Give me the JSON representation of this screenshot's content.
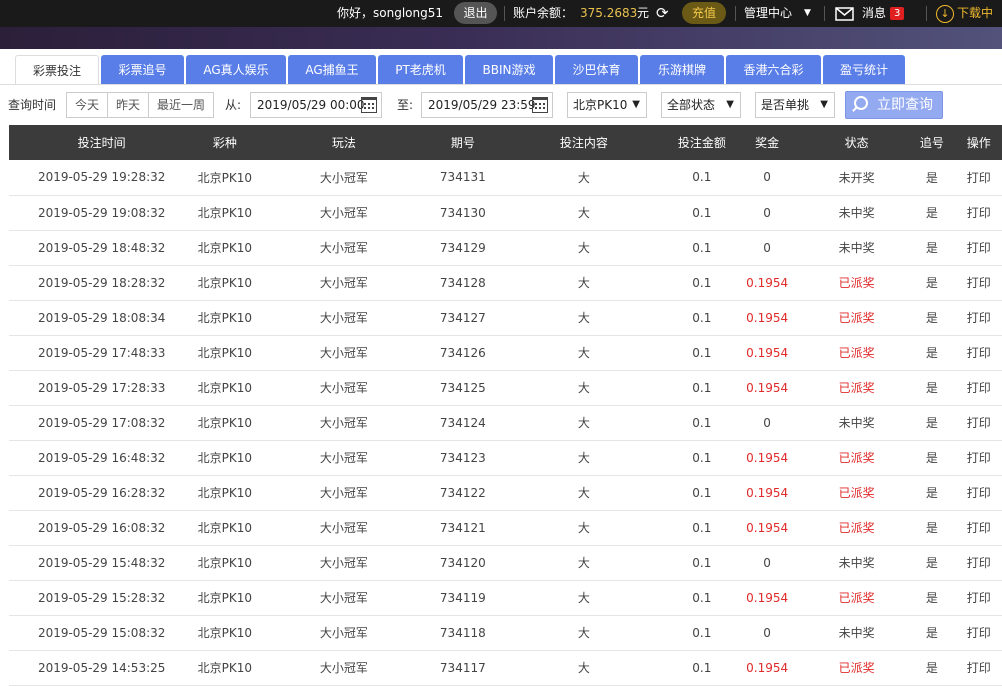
{
  "header": {
    "greeting": "你好，songlong51",
    "logout_label": "退出",
    "balance_label": "账户余额：",
    "balance_value": "375.2683",
    "balance_unit": "元",
    "recharge_label": "充值",
    "admin_label": "管理中心",
    "messages_label": "消息",
    "messages_count": "3",
    "download_label": "下载中"
  },
  "tabs": [
    {
      "label": "彩票投注",
      "active": true
    },
    {
      "label": "彩票追号"
    },
    {
      "label": "AG真人娱乐"
    },
    {
      "label": "AG捕鱼王"
    },
    {
      "label": "PT老虎机"
    },
    {
      "label": "BBIN游戏"
    },
    {
      "label": "沙巴体育"
    },
    {
      "label": "乐游棋牌"
    },
    {
      "label": "香港六合彩"
    },
    {
      "label": "盈亏统计"
    }
  ],
  "filters": {
    "query_time_label": "查询时间",
    "quick": [
      "今天",
      "昨天",
      "最近一周"
    ],
    "from_label": "从:",
    "from_value": "2019/05/29 00:00",
    "to_label": "至:",
    "to_value": "2019/05/29 23:59",
    "lottery_select": "北京PK10",
    "status_select": "全部状态",
    "single_select": "是否单挑",
    "query_button": "立即查询"
  },
  "table": {
    "columns": [
      "投注时间",
      "彩种",
      "玩法",
      "期号",
      "投注内容",
      "投注金额",
      "奖金",
      "状态",
      "追号",
      "操作"
    ],
    "rows": [
      [
        "2019-05-29 19:28:32",
        "北京PK10",
        "大小冠军",
        "734131",
        "大",
        "0.1",
        "0",
        "未开奖",
        "是",
        "打印"
      ],
      [
        "2019-05-29 19:08:32",
        "北京PK10",
        "大小冠军",
        "734130",
        "大",
        "0.1",
        "0",
        "未中奖",
        "是",
        "打印"
      ],
      [
        "2019-05-29 18:48:32",
        "北京PK10",
        "大小冠军",
        "734129",
        "大",
        "0.1",
        "0",
        "未中奖",
        "是",
        "打印"
      ],
      [
        "2019-05-29 18:28:32",
        "北京PK10",
        "大小冠军",
        "734128",
        "大",
        "0.1",
        "0.1954",
        "已派奖",
        "是",
        "打印"
      ],
      [
        "2019-05-29 18:08:34",
        "北京PK10",
        "大小冠军",
        "734127",
        "大",
        "0.1",
        "0.1954",
        "已派奖",
        "是",
        "打印"
      ],
      [
        "2019-05-29 17:48:33",
        "北京PK10",
        "大小冠军",
        "734126",
        "大",
        "0.1",
        "0.1954",
        "已派奖",
        "是",
        "打印"
      ],
      [
        "2019-05-29 17:28:33",
        "北京PK10",
        "大小冠军",
        "734125",
        "大",
        "0.1",
        "0.1954",
        "已派奖",
        "是",
        "打印"
      ],
      [
        "2019-05-29 17:08:32",
        "北京PK10",
        "大小冠军",
        "734124",
        "大",
        "0.1",
        "0",
        "未中奖",
        "是",
        "打印"
      ],
      [
        "2019-05-29 16:48:32",
        "北京PK10",
        "大小冠军",
        "734123",
        "大",
        "0.1",
        "0.1954",
        "已派奖",
        "是",
        "打印"
      ],
      [
        "2019-05-29 16:28:32",
        "北京PK10",
        "大小冠军",
        "734122",
        "大",
        "0.1",
        "0.1954",
        "已派奖",
        "是",
        "打印"
      ],
      [
        "2019-05-29 16:08:32",
        "北京PK10",
        "大小冠军",
        "734121",
        "大",
        "0.1",
        "0.1954",
        "已派奖",
        "是",
        "打印"
      ],
      [
        "2019-05-29 15:48:32",
        "北京PK10",
        "大小冠军",
        "734120",
        "大",
        "0.1",
        "0",
        "未中奖",
        "是",
        "打印"
      ],
      [
        "2019-05-29 15:28:32",
        "北京PK10",
        "大小冠军",
        "734119",
        "大",
        "0.1",
        "0.1954",
        "已派奖",
        "是",
        "打印"
      ],
      [
        "2019-05-29 15:08:32",
        "北京PK10",
        "大小冠军",
        "734118",
        "大",
        "0.1",
        "0",
        "未中奖",
        "是",
        "打印"
      ],
      [
        "2019-05-29 14:53:25",
        "北京PK10",
        "大小冠军",
        "734117",
        "大",
        "0.1",
        "0.1954",
        "已派奖",
        "是",
        "打印"
      ]
    ]
  },
  "colors": {
    "win": "#e02a2a",
    "tab": "#5a7ee8",
    "header_bg": "#3b3b3b"
  }
}
